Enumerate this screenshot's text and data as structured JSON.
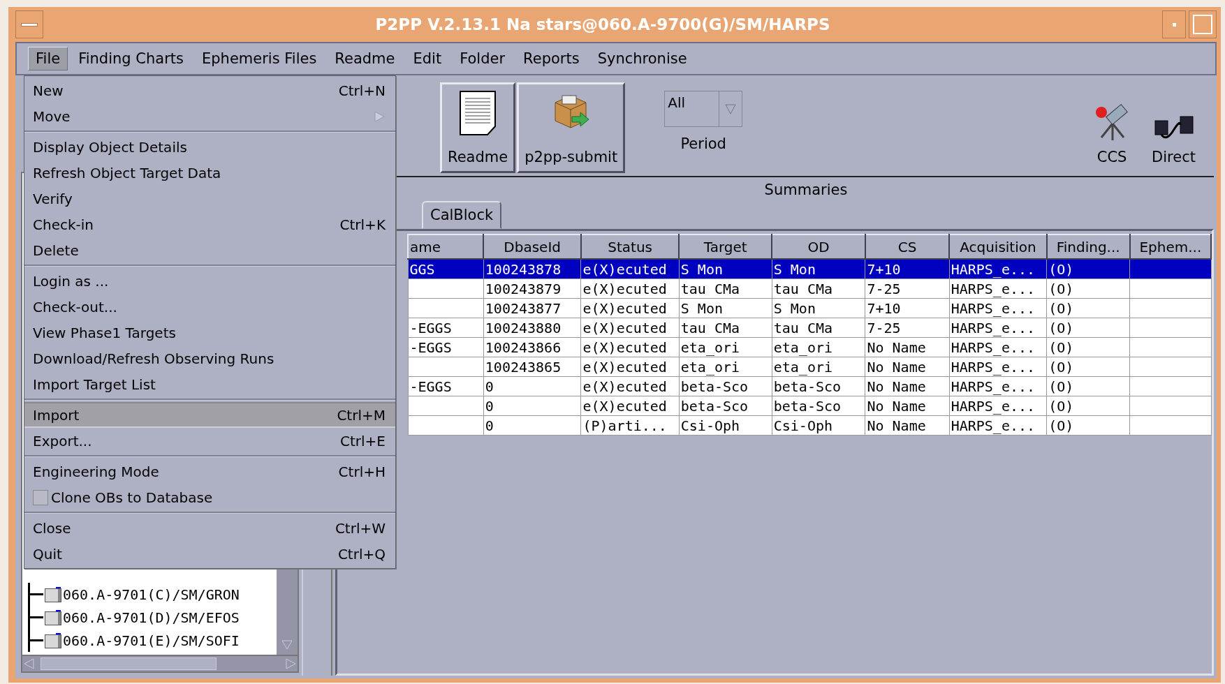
{
  "window": {
    "title": "P2PP V.2.13.1 Na stars@060.A-9700(G)/SM/HARPS"
  },
  "menu_bar": [
    {
      "label": "File",
      "selected": true
    },
    {
      "label": "Finding Charts",
      "selected": false
    },
    {
      "label": "Ephemeris Files",
      "selected": false
    },
    {
      "label": "Readme",
      "selected": false
    },
    {
      "label": "Edit",
      "selected": false
    },
    {
      "label": "Folder",
      "selected": false
    },
    {
      "label": "Reports",
      "selected": false
    },
    {
      "label": "Synchronise",
      "selected": false
    }
  ],
  "file_menu": [
    [
      {
        "kind": "item",
        "label": "New",
        "shortcut": "Ctrl+N",
        "selected": false
      },
      {
        "kind": "submenu",
        "label": "Move",
        "selected": false
      }
    ],
    [
      {
        "kind": "item",
        "label": "Display Object Details",
        "selected": false
      },
      {
        "kind": "item",
        "label": "Refresh Object Target Data",
        "selected": false
      },
      {
        "kind": "item",
        "label": "Verify",
        "selected": false
      },
      {
        "kind": "item",
        "label": "Check-in",
        "shortcut": "Ctrl+K",
        "selected": false
      },
      {
        "kind": "item",
        "label": "Delete",
        "selected": false
      }
    ],
    [
      {
        "kind": "item",
        "label": "Login as ...",
        "selected": false
      },
      {
        "kind": "item",
        "label": "Check-out...",
        "selected": false
      },
      {
        "kind": "item",
        "label": "View Phase1 Targets",
        "selected": false
      },
      {
        "kind": "item",
        "label": "Download/Refresh Observing Runs",
        "selected": false
      },
      {
        "kind": "item",
        "label": "Import Target List",
        "selected": false
      }
    ],
    [
      {
        "kind": "item",
        "label": "Import",
        "shortcut": "Ctrl+M",
        "selected": true
      },
      {
        "kind": "item",
        "label": "Export...",
        "shortcut": "Ctrl+E",
        "selected": false
      }
    ],
    [
      {
        "kind": "item",
        "label": "Engineering Mode",
        "shortcut": "Ctrl+H",
        "selected": false
      },
      {
        "kind": "checkbox",
        "label": "Clone OBs to Database",
        "checked": false,
        "selected": false
      }
    ],
    [
      {
        "kind": "item",
        "label": "Close",
        "shortcut": "Ctrl+W",
        "selected": false
      },
      {
        "kind": "item",
        "label": "Quit",
        "shortcut": "Ctrl+Q",
        "selected": false
      }
    ]
  ],
  "toolbar": {
    "buttons": [
      {
        "kind": "readme",
        "label": "Readme"
      },
      {
        "kind": "submit",
        "label": "p2pp-submit"
      }
    ],
    "period": {
      "value": "All",
      "label": "Period"
    },
    "tools": [
      {
        "kind": "ccs",
        "label": "CCS"
      },
      {
        "kind": "direct",
        "label": "Direct"
      }
    ]
  },
  "summaries_label": "Summaries",
  "tabs": [
    {
      "label": "CalBlock",
      "selected": false
    }
  ],
  "tree": {
    "items": [
      "060.A-9701(C)/SM/GRON",
      "060.A-9701(D)/SM/EFOS",
      "060.A-9701(E)/SM/SOFI"
    ]
  },
  "table": {
    "columns": [
      "ame",
      "DbaseId",
      "Status",
      "Target",
      "OD",
      "CS",
      "Acquisition",
      "Finding...",
      "Ephem..."
    ],
    "rows": [
      {
        "selected": true,
        "cells": [
          "GGS",
          "100243878",
          "e(X)ecuted",
          "S Mon",
          "S Mon",
          "7+10",
          "HARPS_e...",
          "(O)",
          ""
        ]
      },
      {
        "selected": false,
        "cells": [
          "",
          "100243879",
          "e(X)ecuted",
          "tau CMa",
          "tau CMa",
          "7-25",
          "HARPS_e...",
          "(O)",
          ""
        ]
      },
      {
        "selected": false,
        "cells": [
          "",
          "100243877",
          "e(X)ecuted",
          "S Mon",
          "S Mon",
          "7+10",
          "HARPS_e...",
          "(O)",
          ""
        ]
      },
      {
        "selected": false,
        "cells": [
          "-EGGS",
          "100243880",
          "e(X)ecuted",
          "tau CMa",
          "tau CMa",
          "7-25",
          "HARPS_e...",
          "(O)",
          ""
        ]
      },
      {
        "selected": false,
        "cells": [
          "-EGGS",
          "100243866",
          "e(X)ecuted",
          "eta_ori",
          "eta_ori",
          "No Name",
          "HARPS_e...",
          "(O)",
          ""
        ]
      },
      {
        "selected": false,
        "cells": [
          "",
          "100243865",
          "e(X)ecuted",
          "eta_ori",
          "eta_ori",
          "No Name",
          "HARPS_e...",
          "(O)",
          ""
        ]
      },
      {
        "selected": false,
        "cells": [
          "-EGGS",
          "0",
          "e(X)ecuted",
          "beta-Sco",
          "beta-Sco",
          "No Name",
          "HARPS_e...",
          "(O)",
          ""
        ]
      },
      {
        "selected": false,
        "cells": [
          "",
          "0",
          "e(X)ecuted",
          "beta-Sco",
          "beta-Sco",
          "No Name",
          "HARPS_e...",
          "(O)",
          ""
        ]
      },
      {
        "selected": false,
        "cells": [
          "",
          "0",
          "(P)arti...",
          "Csi-Oph",
          "Csi-Oph",
          "No Name",
          "HARPS_e...",
          "(O)",
          ""
        ]
      }
    ]
  }
}
